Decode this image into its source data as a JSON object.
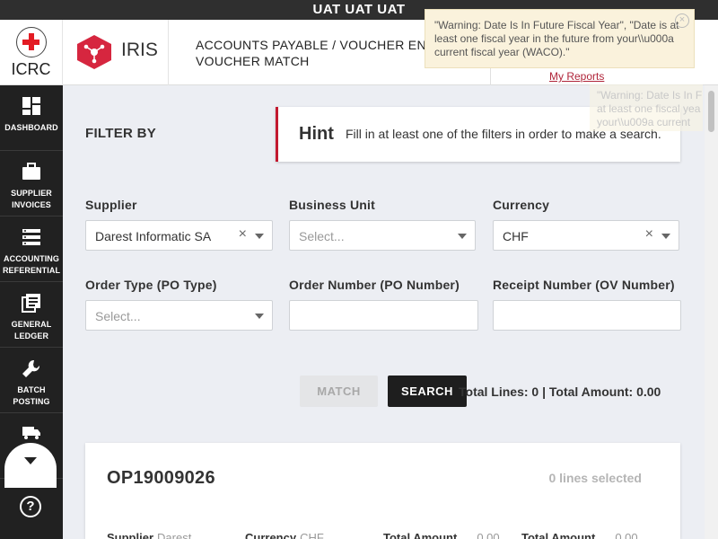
{
  "env_banner": "UAT UAT UAT",
  "header": {
    "org_name": "ICRC",
    "app_name": "IRIS",
    "breadcrumb_line1": "ACCOUNTS PAYABLE / VOUCHER ENT",
    "breadcrumb_line2": "VOUCHER MATCH",
    "my_reports": "My Reports"
  },
  "sidebar": {
    "items": [
      {
        "label_1": "DASHBOARD",
        "label_2": "",
        "icon": "dashboard-icon"
      },
      {
        "label_1": "SUPPLIER",
        "label_2": "INVOICES",
        "icon": "briefcase-icon"
      },
      {
        "label_1": "ACCOUNTING",
        "label_2": "REFERENTIAL",
        "icon": "list-icon"
      },
      {
        "label_1": "GENERAL",
        "label_2": "LEDGER",
        "icon": "ledger-icon"
      },
      {
        "label_1": "BATCH",
        "label_2": "POSTING",
        "icon": "wrench-icon"
      },
      {
        "label_1": "",
        "label_2": "",
        "icon": "truck-icon"
      }
    ],
    "help_glyph": "?"
  },
  "filter": {
    "title": "FILTER BY",
    "hint_title": "Hint",
    "hint_text": "Fill in at least one of the filters in order to make a search.",
    "supplier_label": "Supplier",
    "supplier_value": "Darest Informatic SA",
    "business_unit_label": "Business Unit",
    "business_unit_placeholder": "Select...",
    "currency_label": "Currency",
    "currency_value": "CHF",
    "order_type_label": "Order Type (PO Type)",
    "order_type_placeholder": "Select...",
    "order_number_label": "Order Number (PO Number)",
    "order_number_value": "",
    "receipt_number_label": "Receipt Number (OV Number)",
    "receipt_number_value": "",
    "clear_glyph": "×"
  },
  "actions": {
    "match_label": "MATCH",
    "search_label": "SEARCH",
    "totals": "Total Lines: 0 | Total Amount: 0.00"
  },
  "card": {
    "op_number": "OP19009026",
    "lines_selected": "0 lines selected",
    "supplier_label": "Supplier",
    "supplier_value": "Darest",
    "currency_label": "Currency",
    "currency_value": "CHF",
    "total_amount_label": "Total Amount",
    "total_amount_value": "0.00",
    "total_amount2_label": "Total Amount",
    "total_amount2_value": "0.00"
  },
  "toast": {
    "message": "\"Warning: Date Is In Future Fiscal Year\", \"Date is at least one fiscal year in the future from your\\\\u000a current fiscal year (WACO).\"",
    "close_glyph": "×",
    "ghost_line1": "\"Warning: Date Is In F",
    "ghost_line2": "at least one fiscal yea",
    "ghost_line3": "your\\\\u009a current"
  },
  "colors": {
    "accent": "#c2192f",
    "sidebar_bg": "#212121",
    "iris_brand": "#d6263f",
    "toast_bg": "#faf2dc"
  }
}
